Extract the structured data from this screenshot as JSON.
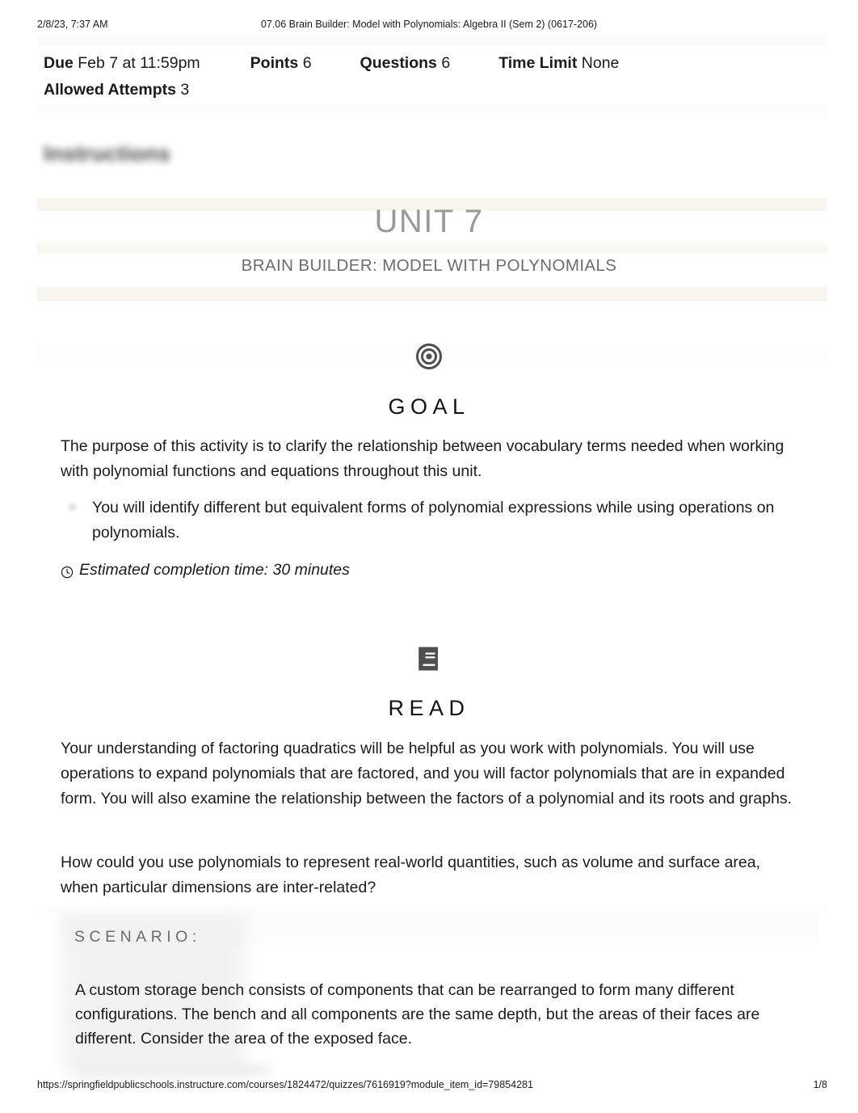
{
  "print_header": {
    "date": "2/8/23, 7:37 AM",
    "title": "07.06 Brain Builder: Model with Polynomials: Algebra II (Sem 2) (0617-206)"
  },
  "quiz_meta": {
    "due_label": "Due",
    "due_value": "Feb 7 at 11:59pm",
    "points_label": "Points",
    "points_value": "6",
    "questions_label": "Questions",
    "questions_value": "6",
    "time_limit_label": "Time Limit",
    "time_limit_value": "None",
    "attempts_label": "Allowed Attempts",
    "attempts_value": "3"
  },
  "instructions_heading": "Instructions",
  "banner": {
    "unit": "UNIT 7",
    "subtitle": "BRAIN BUILDER: MODEL WITH POLYNOMIALS"
  },
  "goal": {
    "icon": "target-icon",
    "title": "GOAL",
    "paragraph": "The purpose of this activity is to clarify the relationship between vocabulary terms needed when working with polynomial functions and equations throughout this unit.",
    "bullet": "You will identify different but equivalent forms of polynomial expressions while using operations on polynomials.",
    "time_icon": "clock-icon",
    "time_text": "Estimated completion time: 30 minutes"
  },
  "read": {
    "icon": "book-icon",
    "title": "READ",
    "paragraph_1": "Your understanding of factoring quadratics will be helpful as you work with polynomials. You will use operations to expand polynomials that are factored, and you will factor polynomials that are in expanded form. You will also examine the relationship between the factors of a polynomial and its roots and graphs.",
    "paragraph_2": "How could you use polynomials to represent real-world quantities, such as volume and surface area, when particular dimensions are inter-related?"
  },
  "scenario": {
    "heading": "SCENARIO:",
    "body": "A custom storage bench consists of components that can be rearranged to form many different configurations. The bench and all components are the same depth, but the areas of their faces are different. Consider the area of the exposed face."
  },
  "print_footer": {
    "url": "https://springfieldpublicschools.instructure.com/courses/1824472/quizzes/7616919?module_item_id=79854281",
    "page": "1/8"
  },
  "colors": {
    "banner_title": "#9a9a9a",
    "banner_subtitle": "#6d6d6d",
    "band_cream": "#f8f5ef",
    "scenario_heading": "#6d6d6d"
  }
}
